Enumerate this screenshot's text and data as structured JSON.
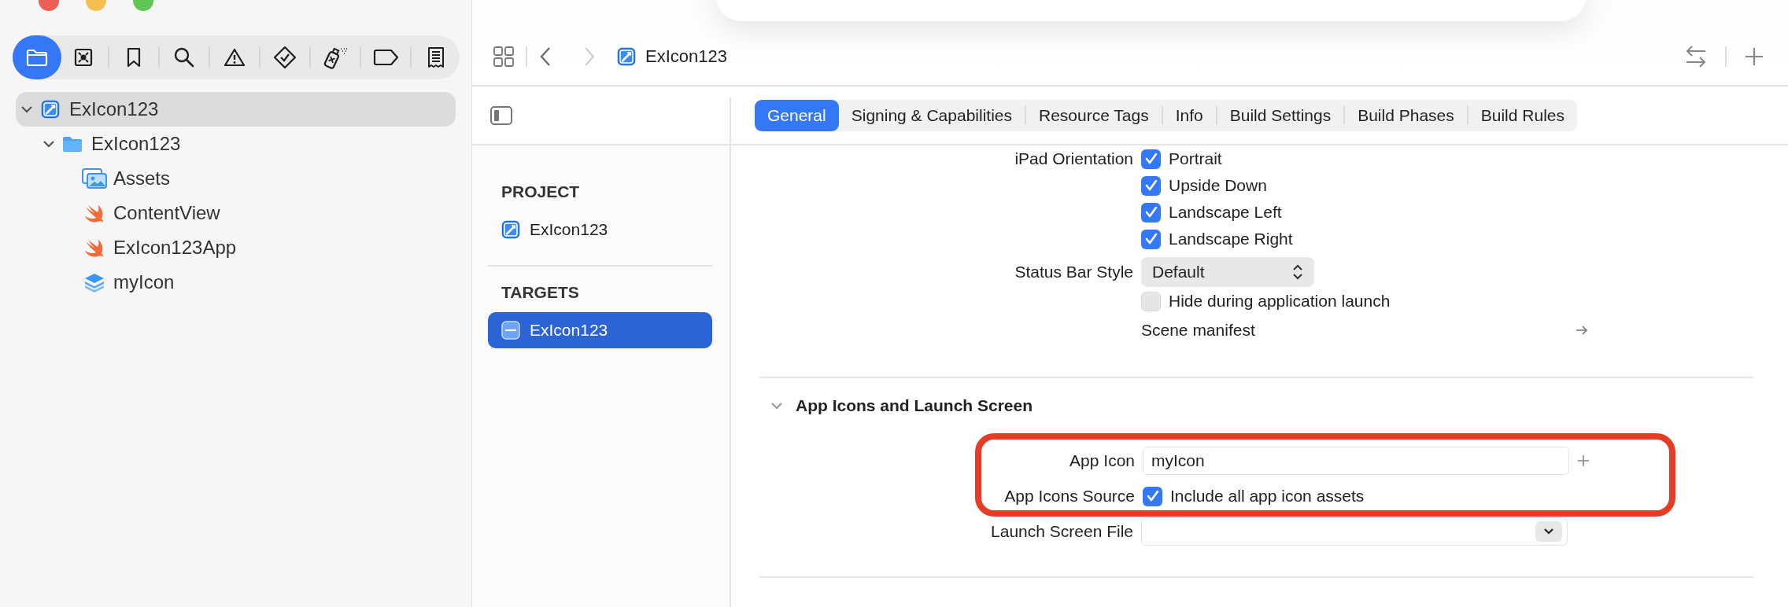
{
  "navigator": {
    "toolbar": [
      {
        "kind": "folder",
        "selected": true
      },
      {
        "kind": "target",
        "selected": false
      },
      {
        "kind": "bookmark",
        "selected": false
      },
      {
        "kind": "search",
        "selected": false
      },
      {
        "kind": "warning",
        "selected": false
      },
      {
        "kind": "test",
        "selected": false
      },
      {
        "kind": "debug",
        "selected": false
      },
      {
        "kind": "tag",
        "selected": false
      },
      {
        "kind": "report",
        "selected": false
      }
    ],
    "tree": [
      {
        "label": "ExIcon123",
        "kind": "project",
        "expanded": true,
        "selected": true,
        "children": [
          {
            "label": "ExIcon123",
            "kind": "folder",
            "expanded": true,
            "selected": false,
            "children": [
              {
                "label": "Assets",
                "kind": "assets",
                "selected": false
              },
              {
                "label": "ContentView",
                "kind": "swift",
                "selected": false
              },
              {
                "label": "ExIcon123App",
                "kind": "swift",
                "selected": false
              },
              {
                "label": "myIcon",
                "kind": "icon",
                "selected": false
              }
            ]
          }
        ]
      }
    ]
  },
  "editor": {
    "navigation": {
      "back_enabled": true,
      "forward_enabled": false
    },
    "breadcrumb": {
      "label": "ExIcon123"
    },
    "tabs": [
      {
        "label": "General",
        "selected": true
      },
      {
        "label": "Signing & Capabilities",
        "selected": false
      },
      {
        "label": "Resource Tags",
        "selected": false
      },
      {
        "label": "Info",
        "selected": false
      },
      {
        "label": "Build Settings",
        "selected": false
      },
      {
        "label": "Build Phases",
        "selected": false
      },
      {
        "label": "Build Rules",
        "selected": false
      }
    ],
    "targets_panel": [
      {
        "title": "PROJECT",
        "items": [
          {
            "label": "ExIcon123",
            "kind": "project",
            "selected": false
          }
        ]
      },
      {
        "title": "TARGETS",
        "items": [
          {
            "label": "ExIcon123",
            "kind": "app",
            "selected": true
          }
        ]
      }
    ],
    "settings": {
      "rows": [
        {
          "kind": "checkbox-group",
          "label": "iPad Orientation",
          "options": [
            {
              "label": "Portrait",
              "checked": true
            },
            {
              "label": "Upside Down",
              "checked": true
            },
            {
              "label": "Landscape Left",
              "checked": true
            },
            {
              "label": "Landscape Right",
              "checked": true
            }
          ]
        },
        {
          "kind": "popup",
          "label": "Status Bar Style",
          "value": "Default"
        },
        {
          "kind": "checkbox",
          "text": "Hide during application launch",
          "checked": false
        },
        {
          "kind": "link",
          "text": "Scene manifest"
        }
      ],
      "sections": [
        {
          "title": "App Icons and Launch Screen",
          "expanded": true,
          "rows": [
            {
              "kind": "text-field",
              "label": "App Icon",
              "value": "myIcon",
              "highlighted": true
            },
            {
              "kind": "checkbox",
              "label": "App Icons Source",
              "text": "Include all app icon assets",
              "checked": true,
              "highlighted": true
            },
            {
              "kind": "dropdown-field",
              "label": "Launch Screen File",
              "highlighted": false
            }
          ]
        }
      ]
    }
  }
}
